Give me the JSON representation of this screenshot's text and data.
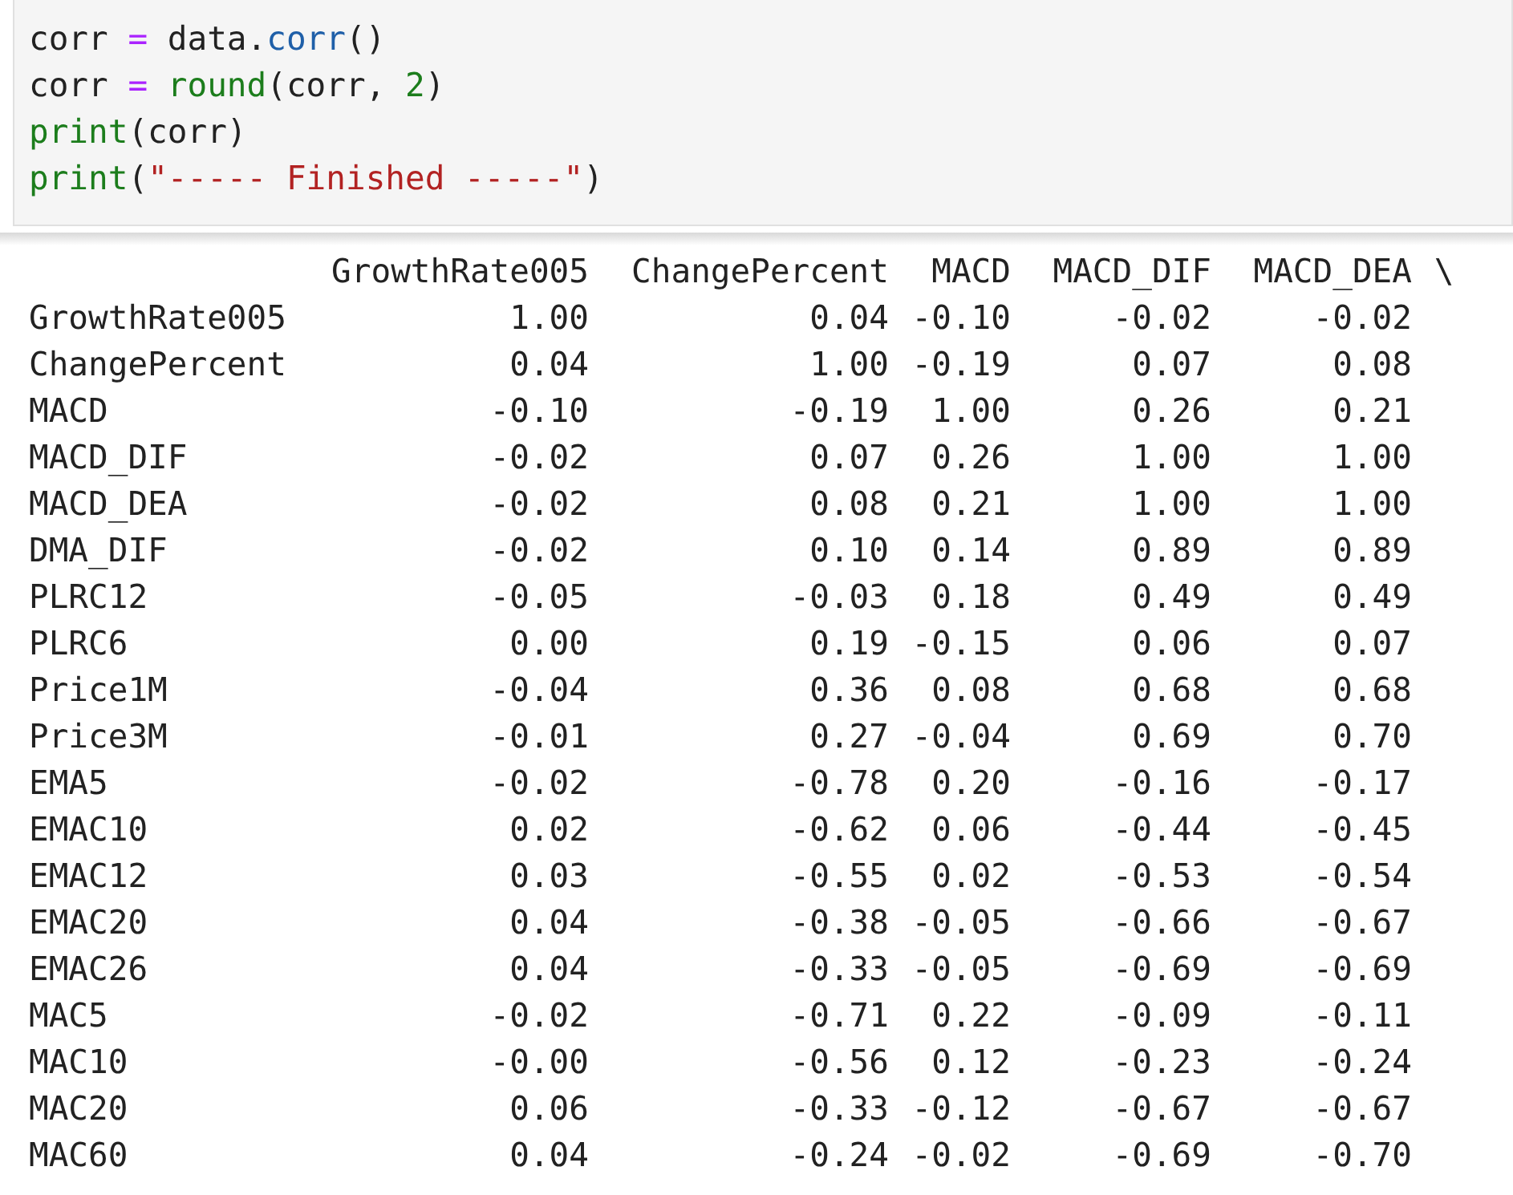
{
  "code_cell": {
    "lines": [
      [
        {
          "kind": "plain",
          "text": "corr "
        },
        {
          "kind": "operator",
          "text": "= "
        },
        {
          "kind": "plain",
          "text": "data."
        },
        {
          "kind": "attr",
          "text": "corr"
        },
        {
          "kind": "plain",
          "text": "()"
        }
      ],
      [
        {
          "kind": "plain",
          "text": "corr "
        },
        {
          "kind": "operator",
          "text": "= "
        },
        {
          "kind": "builtin",
          "text": "round"
        },
        {
          "kind": "plain",
          "text": "(corr, "
        },
        {
          "kind": "number",
          "text": "2"
        },
        {
          "kind": "plain",
          "text": ")"
        }
      ],
      [
        {
          "kind": "builtin",
          "text": "print"
        },
        {
          "kind": "plain",
          "text": "(corr)"
        }
      ],
      [
        {
          "kind": "builtin",
          "text": "print"
        },
        {
          "kind": "plain",
          "text": "("
        },
        {
          "kind": "string",
          "text": "\"----- Finished -----\""
        },
        {
          "kind": "plain",
          "text": ")"
        }
      ]
    ]
  },
  "output": {
    "columns": [
      "GrowthRate005",
      "ChangePercent",
      "MACD",
      "MACD_DIF",
      "MACD_DEA"
    ],
    "continuation": "\\",
    "rows": [
      {
        "label": "GrowthRate005",
        "values": [
          "1.00",
          "0.04",
          "-0.10",
          "-0.02",
          "-0.02"
        ]
      },
      {
        "label": "ChangePercent",
        "values": [
          "0.04",
          "1.00",
          "-0.19",
          "0.07",
          "0.08"
        ]
      },
      {
        "label": "MACD",
        "values": [
          "-0.10",
          "-0.19",
          "1.00",
          "0.26",
          "0.21"
        ]
      },
      {
        "label": "MACD_DIF",
        "values": [
          "-0.02",
          "0.07",
          "0.26",
          "1.00",
          "1.00"
        ]
      },
      {
        "label": "MACD_DEA",
        "values": [
          "-0.02",
          "0.08",
          "0.21",
          "1.00",
          "1.00"
        ]
      },
      {
        "label": "DMA_DIF",
        "values": [
          "-0.02",
          "0.10",
          "0.14",
          "0.89",
          "0.89"
        ]
      },
      {
        "label": "PLRC12",
        "values": [
          "-0.05",
          "-0.03",
          "0.18",
          "0.49",
          "0.49"
        ]
      },
      {
        "label": "PLRC6",
        "values": [
          "0.00",
          "0.19",
          "-0.15",
          "0.06",
          "0.07"
        ]
      },
      {
        "label": "Price1M",
        "values": [
          "-0.04",
          "0.36",
          "0.08",
          "0.68",
          "0.68"
        ]
      },
      {
        "label": "Price3M",
        "values": [
          "-0.01",
          "0.27",
          "-0.04",
          "0.69",
          "0.70"
        ]
      },
      {
        "label": "EMA5",
        "values": [
          "-0.02",
          "-0.78",
          "0.20",
          "-0.16",
          "-0.17"
        ]
      },
      {
        "label": "EMAC10",
        "values": [
          "0.02",
          "-0.62",
          "0.06",
          "-0.44",
          "-0.45"
        ]
      },
      {
        "label": "EMAC12",
        "values": [
          "0.03",
          "-0.55",
          "0.02",
          "-0.53",
          "-0.54"
        ]
      },
      {
        "label": "EMAC20",
        "values": [
          "0.04",
          "-0.38",
          "-0.05",
          "-0.66",
          "-0.67"
        ]
      },
      {
        "label": "EMAC26",
        "values": [
          "0.04",
          "-0.33",
          "-0.05",
          "-0.69",
          "-0.69"
        ]
      },
      {
        "label": "MAC5",
        "values": [
          "-0.02",
          "-0.71",
          "0.22",
          "-0.09",
          "-0.11"
        ]
      },
      {
        "label": "MAC10",
        "values": [
          "-0.00",
          "-0.56",
          "0.12",
          "-0.23",
          "-0.24"
        ]
      },
      {
        "label": "MAC20",
        "values": [
          "0.06",
          "-0.33",
          "-0.12",
          "-0.67",
          "-0.67"
        ]
      },
      {
        "label": "MAC60",
        "values": [
          "0.04",
          "-0.24",
          "-0.02",
          "-0.69",
          "-0.70"
        ]
      }
    ]
  }
}
